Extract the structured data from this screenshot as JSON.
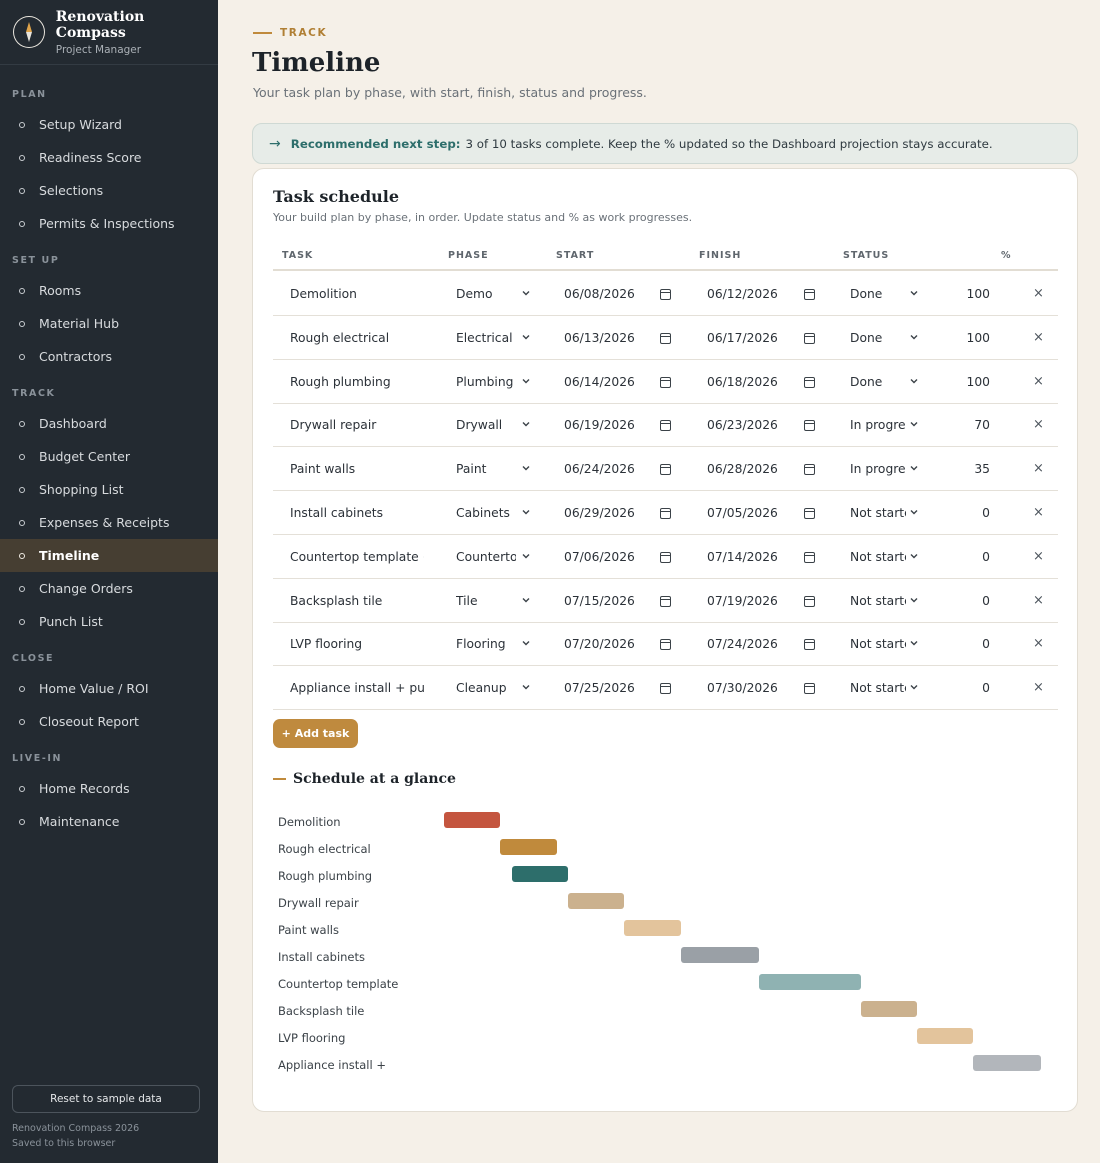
{
  "app": {
    "name": "Renovation Compass",
    "subtitle": "Project Manager"
  },
  "sidebar": {
    "sections": [
      {
        "label": "PLAN",
        "items": [
          "Setup Wizard",
          "Readiness Score",
          "Selections",
          "Permits & Inspections"
        ]
      },
      {
        "label": "SET UP",
        "items": [
          "Rooms",
          "Material Hub",
          "Contractors"
        ]
      },
      {
        "label": "TRACK",
        "items": [
          "Dashboard",
          "Budget Center",
          "Shopping List",
          "Expenses & Receipts",
          "Timeline",
          "Change Orders",
          "Punch List"
        ]
      },
      {
        "label": "CLOSE",
        "items": [
          "Home Value / ROI",
          "Closeout Report"
        ]
      },
      {
        "label": "LIVE-IN",
        "items": [
          "Home Records",
          "Maintenance"
        ]
      }
    ],
    "active": "Timeline",
    "reset_label": "Reset to sample data",
    "footer_line1": "Renovation Compass 2026",
    "footer_line2": "Saved to this browser"
  },
  "header": {
    "eyebrow": "TRACK",
    "title": "Timeline",
    "subtitle": "Your task plan by phase, with start, finish, status and progress."
  },
  "banner": {
    "label": "Recommended next step:",
    "text": "3 of 10 tasks complete. Keep the % updated so the Dashboard projection stays accurate."
  },
  "schedule": {
    "title": "Task schedule",
    "subtitle": "Your build plan by phase, in order. Update status and % as work progresses.",
    "columns": {
      "task": "TASK",
      "phase": "PHASE",
      "start": "START",
      "finish": "FINISH",
      "status": "STATUS",
      "pct": "%"
    },
    "rows": [
      {
        "task": "Demolition",
        "phase": "Demo",
        "start": "06/08/2026",
        "finish": "06/12/2026",
        "status": "Done",
        "pct": "100"
      },
      {
        "task": "Rough electrical",
        "phase": "Electrical",
        "start": "06/13/2026",
        "finish": "06/17/2026",
        "status": "Done",
        "pct": "100"
      },
      {
        "task": "Rough plumbing",
        "phase": "Plumbing",
        "start": "06/14/2026",
        "finish": "06/18/2026",
        "status": "Done",
        "pct": "100"
      },
      {
        "task": "Drywall repair",
        "phase": "Drywall",
        "start": "06/19/2026",
        "finish": "06/23/2026",
        "status": "In progres",
        "pct": "70"
      },
      {
        "task": "Paint walls",
        "phase": "Paint",
        "start": "06/24/2026",
        "finish": "06/28/2026",
        "status": "In progres",
        "pct": "35"
      },
      {
        "task": "Install cabinets",
        "phase": "Cabinets",
        "start": "06/29/2026",
        "finish": "07/05/2026",
        "status": "Not starte",
        "pct": "0"
      },
      {
        "task": "Countertop template +",
        "phase": "Countertop",
        "start": "07/06/2026",
        "finish": "07/14/2026",
        "status": "Not starte",
        "pct": "0"
      },
      {
        "task": "Backsplash tile",
        "phase": "Tile",
        "start": "07/15/2026",
        "finish": "07/19/2026",
        "status": "Not starte",
        "pct": "0"
      },
      {
        "task": "LVP flooring",
        "phase": "Flooring",
        "start": "07/20/2026",
        "finish": "07/24/2026",
        "status": "Not starte",
        "pct": "0"
      },
      {
        "task": "Appliance install + punc",
        "phase": "Cleanup",
        "start": "07/25/2026",
        "finish": "07/30/2026",
        "status": "Not starte",
        "pct": "0"
      }
    ],
    "add_label": "+ Add task"
  },
  "glance": {
    "title": "Schedule at a glance",
    "range_start": "2026-06-08",
    "range_end": "2026-07-30",
    "tasks": [
      {
        "label": "Demolition",
        "start": "2026-06-08",
        "end": "2026-06-12",
        "color": "#c4553f"
      },
      {
        "label": "Rough electrical",
        "start": "2026-06-13",
        "end": "2026-06-17",
        "color": "#c08a3c"
      },
      {
        "label": "Rough plumbing",
        "start": "2026-06-14",
        "end": "2026-06-18",
        "color": "#2d6e6b"
      },
      {
        "label": "Drywall repair",
        "start": "2026-06-19",
        "end": "2026-06-23",
        "color": "#cbb18e"
      },
      {
        "label": "Paint walls",
        "start": "2026-06-24",
        "end": "2026-06-28",
        "color": "#e3c49c"
      },
      {
        "label": "Install cabinets",
        "start": "2026-06-29",
        "end": "2026-07-05",
        "color": "#9aa0a6"
      },
      {
        "label": "Countertop template",
        "start": "2026-07-06",
        "end": "2026-07-14",
        "color": "#8fb2b2"
      },
      {
        "label": "Backsplash tile",
        "start": "2026-07-15",
        "end": "2026-07-19",
        "color": "#cbb18e"
      },
      {
        "label": "LVP flooring",
        "start": "2026-07-20",
        "end": "2026-07-24",
        "color": "#e3c49c"
      },
      {
        "label": "Appliance install +",
        "start": "2026-07-25",
        "end": "2026-07-30",
        "color": "#b2b6bb"
      }
    ]
  }
}
